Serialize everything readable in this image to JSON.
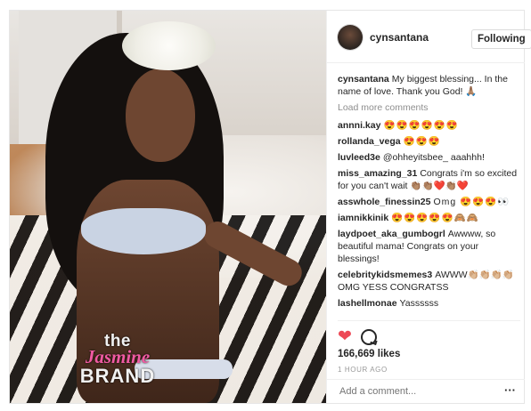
{
  "post": {
    "username": "cynsantana",
    "follow_label": "Following",
    "caption_user": "cynsantana",
    "caption_text": "My biggest blessing... In the name of love. Thank you God! 🙏🏽",
    "load_more": "Load more comments",
    "comments": [
      {
        "user": "annni.kay",
        "text": "😍😍😍😍😍😍"
      },
      {
        "user": "rollanda_vega",
        "text": "😍😍😍"
      },
      {
        "user": "luvleed3e",
        "text": "@ohheyitsbee_ aaahhh!"
      },
      {
        "user": "miss_amazing_31",
        "text": "Congrats i'm so excited for you can't wait 👏🏽👏🏽❤️👏🏽❤️"
      },
      {
        "user": "asswhole_finessin25",
        "text": "Omg 😍😍😍👀"
      },
      {
        "user": "iamnikkinik",
        "text": "😍😍😍😍😍🙈🙈"
      },
      {
        "user": "laydpoet_aka_gumbogrl",
        "text": "Awwww, so beautiful mama! Congrats on your blessings!"
      },
      {
        "user": "celebritykidsmemes3",
        "text": "AWWW👏🏼👏🏼👏🏼👏🏼 OMG YESS CONGRATSS"
      },
      {
        "user": "lashellmonae",
        "text": "Yassssss"
      }
    ],
    "likes": "166,669 likes",
    "time": "1 HOUR AGO",
    "add_comment_placeholder": "Add a comment...",
    "more_label": "···"
  },
  "watermark": {
    "line1": "the",
    "line2": "Jasmine",
    "line3": "BRAND"
  },
  "icons": {
    "like": "heart-icon",
    "comment": "comment-icon",
    "options": "more-options-icon"
  },
  "colors": {
    "heart": "#ed4956",
    "watermark_pink": "#f05aa2"
  }
}
